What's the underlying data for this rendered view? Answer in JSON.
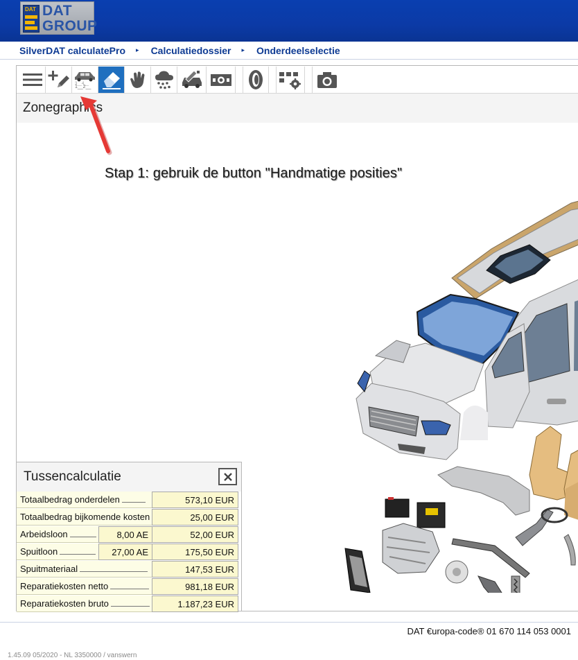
{
  "header": {
    "logo_small": "DAT",
    "logo_line1": "DAT",
    "logo_line2": "GROUP"
  },
  "breadcrumb": {
    "items": [
      "SilverDAT calculatePro",
      "Calculatiedossier",
      "Onderdeelselectie"
    ],
    "separator": "▸"
  },
  "toolbar": {
    "icons": [
      "menu-icon",
      "add-edit-icon",
      "car-positions-icon",
      "eraser-icon",
      "hand-icon",
      "hail-icon",
      "repair-tools-icon",
      "money-icon",
      "tire-icon",
      "settings-grid-icon",
      "camera-icon"
    ],
    "active": "eraser-icon",
    "accent": "#1f6fbf"
  },
  "panel": {
    "title": "Zonegraphics"
  },
  "instruction": "Stap 1: gebruik de button \"Handmatige posities\"",
  "calc": {
    "title": "Tussencalculatie",
    "rows": [
      {
        "label": "Totaalbedrag onderdelen",
        "ae": "",
        "value": "573,10 EUR"
      },
      {
        "label": "Totaalbedrag bijkomende kosten",
        "ae": "",
        "value": "25,00 EUR"
      },
      {
        "label": "Arbeidsloon",
        "ae": "8,00 AE",
        "value": "52,00 EUR"
      },
      {
        "label": "Spuitloon",
        "ae": "27,00 AE",
        "value": "175,50 EUR"
      },
      {
        "label": "Spuitmateriaal",
        "ae": "",
        "value": "147,53 EUR"
      },
      {
        "label": "Reparatiekosten netto",
        "ae": "",
        "value": "981,18 EUR"
      },
      {
        "label": "Reparatiekosten bruto",
        "ae": "",
        "value": "1.187,23 EUR"
      }
    ]
  },
  "footer": {
    "code": "DAT €uropa-code® 01 670 114 053 0001",
    "version": "1.45.09   05/2020 - NL   3350000 / vanswern"
  },
  "colors": {
    "header": "#0b3aa6",
    "link": "#0d3a93",
    "arrow": "#e53935",
    "calc_bg": "#fbf8cf"
  }
}
